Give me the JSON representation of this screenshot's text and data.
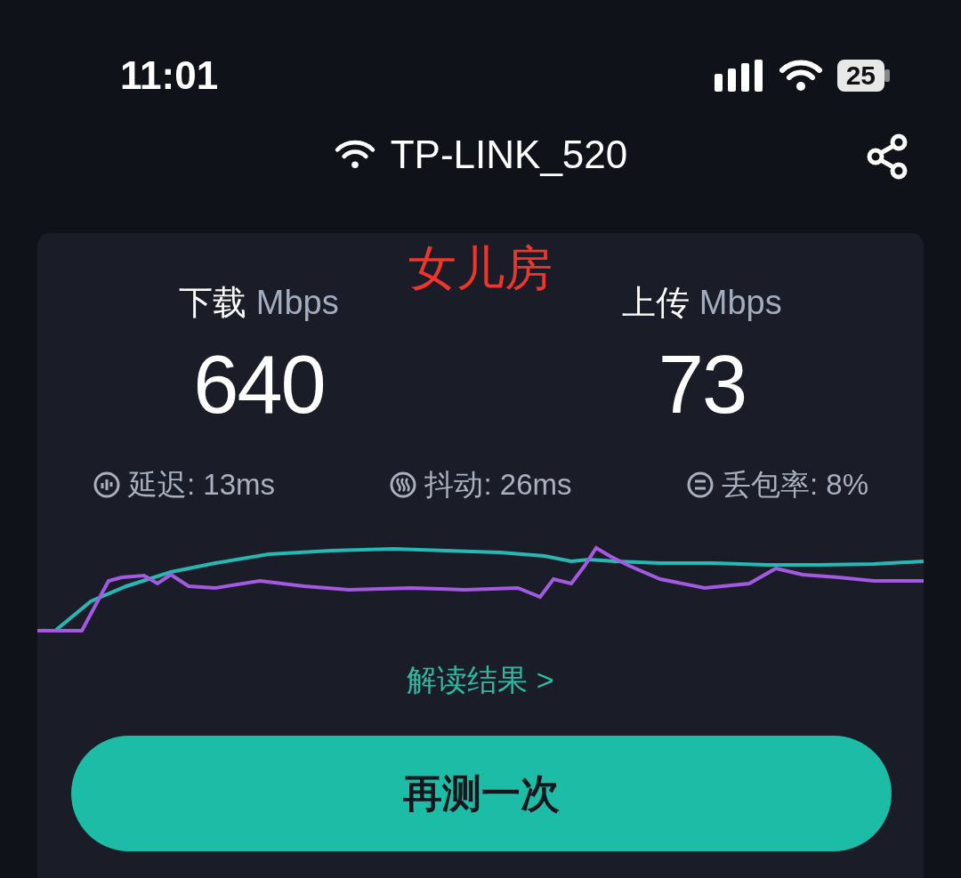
{
  "status_bar": {
    "time": "11:01",
    "battery": "25"
  },
  "header": {
    "network_name": "TP-LINK_520"
  },
  "annotation": "女儿房",
  "metrics": [
    {
      "label": "下载",
      "unit": "Mbps",
      "value": "640"
    },
    {
      "label": "上传",
      "unit": "Mbps",
      "value": "73"
    }
  ],
  "stats": [
    {
      "kind": "latency",
      "text": "延迟: 13ms"
    },
    {
      "kind": "jitter",
      "text": "抖动: 26ms"
    },
    {
      "kind": "loss",
      "text": "丢包率: 8%"
    }
  ],
  "link": "解读结果 >",
  "button": "再测一次"
}
